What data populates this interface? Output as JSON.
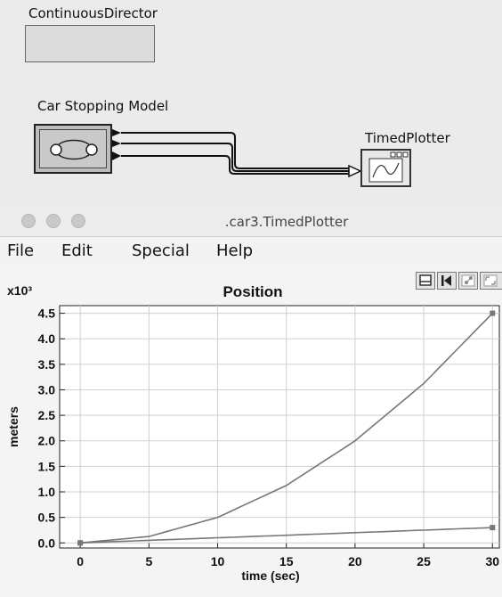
{
  "canvas": {
    "director_label": "ContinuousDirector",
    "model_label": "Car Stopping Model",
    "plotter_label": "TimedPlotter"
  },
  "window": {
    "title": ".car3.TimedPlotter"
  },
  "menu": {
    "items": [
      "File",
      "Edit",
      "Special",
      "Help"
    ]
  },
  "toolbar": {
    "icons": [
      "print-icon",
      "reset-axes-icon",
      "format-icon",
      "fill-icon"
    ]
  },
  "chart_data": {
    "type": "line",
    "title": "Position",
    "xlabel": "time (sec)",
    "ylabel": "meters",
    "y_exponent_label": "x10³",
    "xlim": [
      -1.5,
      30.5
    ],
    "ylim": [
      -0.1,
      4.65
    ],
    "xticks": [
      "0",
      "5",
      "10",
      "15",
      "20",
      "25",
      "30"
    ],
    "yticks": [
      "0.0",
      "0.5",
      "1.0",
      "1.5",
      "2.0",
      "2.5",
      "3.0",
      "3.5",
      "4.0",
      "4.5"
    ],
    "grid": true,
    "series": [
      {
        "color": "#777777",
        "x": [
          0,
          5,
          10,
          15,
          20,
          25,
          30
        ],
        "y": [
          0.0,
          0.125,
          0.5,
          1.125,
          2.0,
          3.125,
          4.5
        ]
      },
      {
        "color": "#777777",
        "x": [
          0,
          5,
          10,
          15,
          20,
          25,
          30
        ],
        "y": [
          0.0,
          0.05,
          0.1,
          0.15,
          0.2,
          0.25,
          0.3
        ]
      }
    ]
  }
}
